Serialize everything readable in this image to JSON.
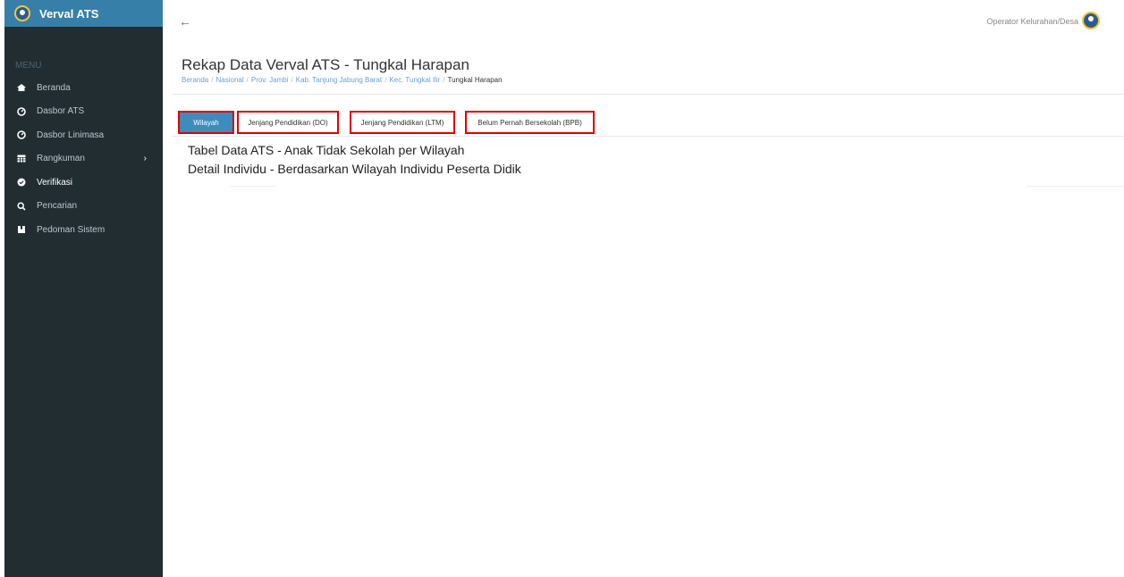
{
  "app": {
    "name": "Verval ATS"
  },
  "sidebar": {
    "menu_header": "MENU",
    "items": [
      {
        "label": "Beranda",
        "icon": "home-icon"
      },
      {
        "label": "Dasbor ATS",
        "icon": "dashboard-icon"
      },
      {
        "label": "Dasbor Linimasa",
        "icon": "dashboard-icon"
      },
      {
        "label": "Rangkuman",
        "icon": "table-icon",
        "has_children": true
      },
      {
        "label": "Verifikasi",
        "icon": "check-circle-icon"
      },
      {
        "label": "Pencarian",
        "icon": "search-icon"
      },
      {
        "label": "Pedoman Sistem",
        "icon": "book-icon"
      }
    ]
  },
  "topbar": {
    "back_symbol": "←",
    "user_role": "Operator Kelurahan/Desa"
  },
  "page": {
    "title": "Rekap Data Verval ATS - Tungkal Harapan",
    "breadcrumb": [
      "Beranda",
      "Nasional",
      "Prov. Jambi",
      "Kab. Tanjung Jabung Barat",
      "Kec. Tungkal Ilir"
    ],
    "breadcrumb_current": "Tungkal Harapan",
    "breadcrumb_separator": "/"
  },
  "tabs": [
    {
      "label": "Wilayah",
      "active": true
    },
    {
      "label": "Jenjang Pendidikan (DO)",
      "active": false
    },
    {
      "label": "Jenjang Pendidikan (LTM)",
      "active": false
    },
    {
      "label": "Belum Pernah Bersekolah (BPB)",
      "active": false
    }
  ],
  "content": {
    "heading_1": "Tabel Data ATS - Anak Tidak Sekolah per Wilayah",
    "heading_2": "Detail Individu - Berdasarkan Wilayah Individu Peserta Didik"
  },
  "colors": {
    "sidebar_bg": "#222d32",
    "brand_bg": "#367fa9",
    "active_tab": "#3c8dbc",
    "highlight_border": "#e00000"
  }
}
